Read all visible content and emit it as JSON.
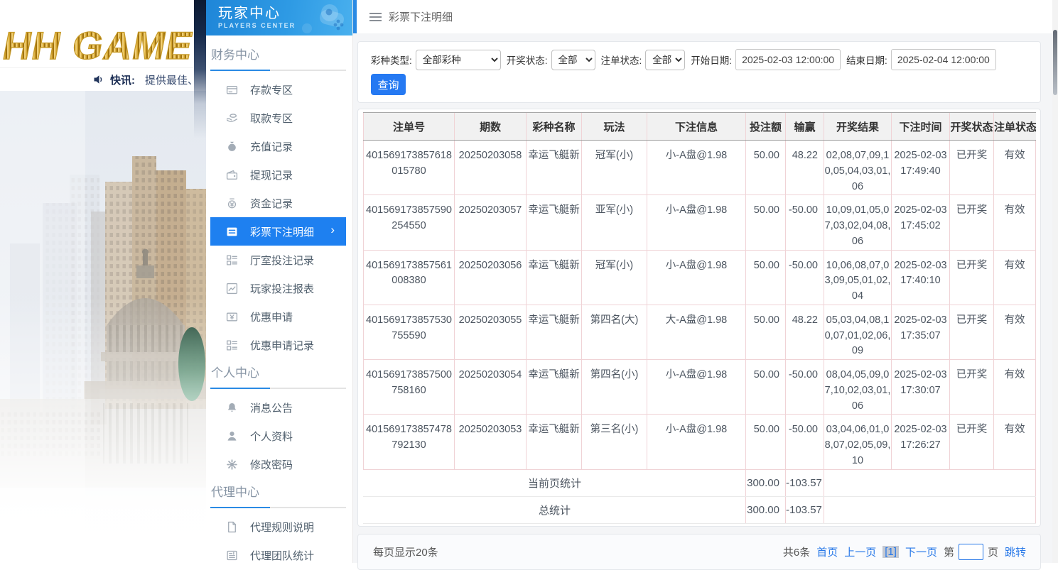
{
  "brand": {
    "logo": "HH GAME",
    "news_label": "快讯:",
    "news_text": "提供最佳、"
  },
  "sidebar": {
    "title": "玩家中心",
    "subtitle": "PLAYERS CENTER",
    "sections": [
      {
        "label": "财务中心",
        "items": [
          {
            "label": "存款专区",
            "icon": "deposit"
          },
          {
            "label": "取款专区",
            "icon": "withdraw"
          },
          {
            "label": "充值记录",
            "icon": "recharge"
          },
          {
            "label": "提现记录",
            "icon": "cashout"
          },
          {
            "label": "资金记录",
            "icon": "funds"
          },
          {
            "label": "彩票下注明细",
            "icon": "bet-detail",
            "active": true
          },
          {
            "label": "厅室投注记录",
            "icon": "room-bets"
          },
          {
            "label": "玩家投注报表",
            "icon": "report"
          },
          {
            "label": "优惠申请",
            "icon": "promo-apply"
          },
          {
            "label": "优惠申请记录",
            "icon": "promo-record"
          }
        ]
      },
      {
        "label": "个人中心",
        "items": [
          {
            "label": "消息公告",
            "icon": "bell"
          },
          {
            "label": "个人资料",
            "icon": "profile"
          },
          {
            "label": "修改密码",
            "icon": "gear"
          },
          {
            "label": "代理中心",
            "is_header": true
          },
          {
            "label": "代理规则说明",
            "icon": "doc"
          },
          {
            "label": "代理团队统计",
            "icon": "team"
          }
        ]
      }
    ]
  },
  "topbar": {
    "title": "彩票下注明细"
  },
  "filters": {
    "lottery_type": {
      "label": "彩种类型:",
      "value": "全部彩种"
    },
    "draw_status": {
      "label": "开奖状态:",
      "value": "全部"
    },
    "bet_status": {
      "label": "注单状态:",
      "value": "全部"
    },
    "start_date": {
      "label": "开始日期:",
      "value": "2025-02-03 12:00:00"
    },
    "end_date": {
      "label": "结束日期:",
      "value": "2025-02-04 12:00:00"
    },
    "query_label": "查询"
  },
  "table": {
    "columns": [
      "注单号",
      "期数",
      "彩种名称",
      "玩法",
      "下注信息",
      "投注额",
      "输赢",
      "开奖结果",
      "下注时间",
      "开奖状态",
      "注单状态"
    ],
    "rows": [
      [
        "401569173857618015780",
        "20250203058",
        "幸运飞艇新",
        "冠军(小)",
        "小-A盘@1.98",
        "50.00",
        "48.22",
        "02,08,07,09,10,05,04,03,01,06",
        "2025-02-03 17:49:40",
        "已开奖",
        "有效"
      ],
      [
        "401569173857590254550",
        "20250203057",
        "幸运飞艇新",
        "亚军(小)",
        "小-A盘@1.98",
        "50.00",
        "-50.00",
        "10,09,01,05,07,03,02,04,08,06",
        "2025-02-03 17:45:02",
        "已开奖",
        "有效"
      ],
      [
        "401569173857561008380",
        "20250203056",
        "幸运飞艇新",
        "冠军(小)",
        "小-A盘@1.98",
        "50.00",
        "-50.00",
        "10,06,08,07,03,09,05,01,02,04",
        "2025-02-03 17:40:10",
        "已开奖",
        "有效"
      ],
      [
        "401569173857530755590",
        "20250203055",
        "幸运飞艇新",
        "第四名(大)",
        "大-A盘@1.98",
        "50.00",
        "48.22",
        "05,03,04,08,10,07,01,02,06,09",
        "2025-02-03 17:35:07",
        "已开奖",
        "有效"
      ],
      [
        "401569173857500758160",
        "20250203054",
        "幸运飞艇新",
        "第四名(小)",
        "小-A盘@1.98",
        "50.00",
        "-50.00",
        "08,04,05,09,07,10,02,03,01,06",
        "2025-02-03 17:30:07",
        "已开奖",
        "有效"
      ],
      [
        "401569173857478792130",
        "20250203053",
        "幸运飞艇新",
        "第三名(小)",
        "小-A盘@1.98",
        "50.00",
        "-50.00",
        "03,04,06,01,08,07,02,05,09,10",
        "2025-02-03 17:26:27",
        "已开奖",
        "有效"
      ]
    ],
    "summary": [
      {
        "label": "当前页统计",
        "bet": "300.00",
        "win": "-103.57"
      },
      {
        "label": "总统计",
        "bet": "300.00",
        "win": "-103.57"
      }
    ]
  },
  "pagination": {
    "page_size": "每页显示20条",
    "total": "共6条",
    "first": "首页",
    "prev": "上一页",
    "current": "[1]",
    "next": "下一页",
    "jump_prefix": "第",
    "jump_suffix": "页",
    "jump_value": "",
    "jump_label": "跳转"
  },
  "colors": {
    "accent": "#2579f2",
    "sidebar_active": "#1e80f0",
    "header_blue": "#2e9ae4",
    "gold": "#d9a92f"
  }
}
